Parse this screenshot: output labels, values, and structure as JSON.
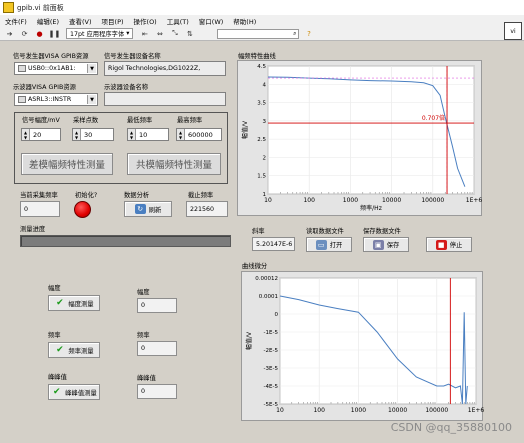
{
  "window": {
    "title": "gpib.vi 前面板"
  },
  "menu": [
    "文件(F)",
    "编辑(E)",
    "查看(V)",
    "项目(P)",
    "操作(O)",
    "工具(T)",
    "窗口(W)",
    "帮助(H)"
  ],
  "toolbar": {
    "font_label": "17pt 应用程序字体",
    "search_icon": "search-icon",
    "help": "?"
  },
  "vi_icon_label": "vi",
  "signal_gen": {
    "label": "信号发生器VISA GPIB资源",
    "value": "USB0::0x1AB1:",
    "device_label": "信号发生器设备名称",
    "device_value": "Rigol Technologies,DG1022Z,"
  },
  "scope": {
    "label": "示波器VISA GPIB资源",
    "value": "ASRL3::INSTR",
    "device_label": "示波器设备名称",
    "device_value": ""
  },
  "params": {
    "amplitude_label": "信号幅度/mV",
    "amplitude_value": "20",
    "points_label": "采样点数",
    "points_value": "30",
    "min_freq_label": "最低频率",
    "min_freq_value": "10",
    "max_freq_label": "最高频率",
    "max_freq_value": "600000",
    "diff_button": "差模幅频特性测量",
    "common_button": "共模幅频特性测量"
  },
  "status": {
    "current_freq_label": "当前采集频率",
    "current_freq_value": "0",
    "init_label": "初始化?",
    "data_label": "数据分析",
    "refresh_button": "刷新",
    "cutoff_label": "截止频率",
    "cutoff_value": "221560",
    "progress_label": "测量进度",
    "progress": 0.0
  },
  "files": {
    "slope_label": "斜率",
    "slope_value": "5.20147E-6",
    "read_label": "读取数据文件",
    "open_button": "打开",
    "save_label": "保存数据文件",
    "save_button": "保存",
    "stop_button": "停止"
  },
  "measure": {
    "amp_label": "幅度",
    "amp_button": "幅度测量",
    "amp_out_label": "幅度",
    "amp_out_value": "0",
    "freq_label": "频率",
    "freq_button": "频率测量",
    "freq_out_label": "频率",
    "freq_out_value": "0",
    "pp_label": "峰峰值",
    "pp_button": "峰峰值测量",
    "pp_out_label": "峰峰值",
    "pp_out_value": "0"
  },
  "watermark": "CSDN @qq_35880100",
  "colors": {
    "panel": "#d4d0c8",
    "plot_bg": "#ffffff",
    "trace": "#4a7fc1",
    "cursor": "#d00000",
    "cutoff_dash": "#e060e0"
  },
  "chart_data": [
    {
      "type": "line",
      "title": "幅频特性曲线",
      "xlabel": "频率/Hz",
      "ylabel": "幅值/V",
      "xscale": "log",
      "xlim": [
        10,
        1000000
      ],
      "ylim": [
        1.0,
        4.5
      ],
      "x_tick_labels": [
        "10",
        "100",
        "1000",
        "10000",
        "100000",
        "1E+6"
      ],
      "y_tick_labels": [
        "1",
        "1.5",
        "2",
        "2.5",
        "3",
        "3.5",
        "4",
        "4.5"
      ],
      "cursor_label": "0.707倍",
      "cursor_x": 221560,
      "cursor_y": 2.94,
      "series": [
        {
          "x": [
            10,
            30,
            100,
            300,
            1000,
            3000,
            10000,
            30000,
            60000,
            100000,
            150000,
            200000,
            300000,
            400000,
            600000
          ],
          "y": [
            4.2,
            4.19,
            4.17,
            4.15,
            4.12,
            4.1,
            4.09,
            4.07,
            4.04,
            3.96,
            3.7,
            3.1,
            2.3,
            1.7,
            1.2
          ]
        }
      ],
      "dashed_level": 4.17
    },
    {
      "type": "line",
      "title": "曲线微分",
      "xlabel": "",
      "ylabel": "幅值/V",
      "xscale": "log",
      "xlim": [
        10,
        1000000
      ],
      "ylim": [
        -0.0005,
        0.00012
      ],
      "x_tick_labels": [
        "10",
        "100",
        "1000",
        "10000",
        "100000",
        "1E+6"
      ],
      "y_tick_labels": [
        "0.00012",
        "0.0001",
        "0",
        "-1E-5",
        "-2E-5",
        "-3E-5",
        "-4E-5",
        "-5E-5"
      ],
      "cursor_x": 221560,
      "series": [
        {
          "x": [
            10,
            30,
            100,
            300,
            1000,
            3000,
            10000,
            30000,
            100000,
            150000,
            200000,
            300000,
            400000,
            450000,
            500000,
            550000,
            600000
          ],
          "y": [
            0.0001,
            8e-05,
            5e-05,
            3e-05,
            1e-05,
            -1e-05,
            -2.5e-05,
            -3.5e-05,
            -4e-05,
            -4e-05,
            -3.9e-05,
            -4.1e-05,
            -4e-05,
            -0.0001,
            1e-05,
            -0.00012,
            -4e-05
          ]
        }
      ]
    }
  ]
}
